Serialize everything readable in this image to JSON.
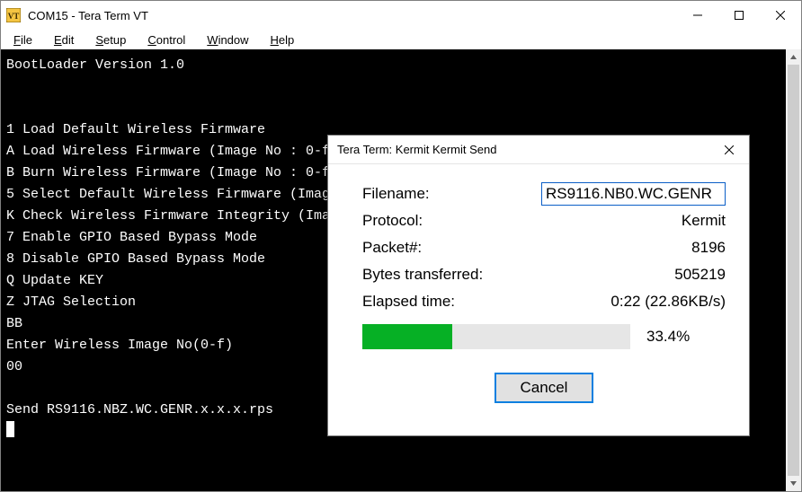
{
  "window": {
    "title": "COM15 - Tera Term VT"
  },
  "menu": {
    "file": {
      "label": "File",
      "accel": "F"
    },
    "edit": {
      "label": "Edit",
      "accel": "E"
    },
    "setup": {
      "label": "Setup",
      "accel": "S"
    },
    "control": {
      "label": "Control",
      "accel": "C"
    },
    "window": {
      "label": "Window",
      "accel": "W"
    },
    "help": {
      "label": "Help",
      "accel": "H"
    }
  },
  "terminal": {
    "lines": [
      "BootLoader Version 1.0",
      "",
      "",
      "1 Load Default Wireless Firmware",
      "A Load Wireless Firmware (Image No : 0-f)",
      "B Burn Wireless Firmware (Image No : 0-f)",
      "5 Select Default Wireless Firmware (Image No : 0-f)",
      "K Check Wireless Firmware Integrity (Image No : 0-f)",
      "7 Enable GPIO Based Bypass Mode",
      "8 Disable GPIO Based Bypass Mode",
      "Q Update KEY",
      "Z JTAG Selection",
      "BB",
      "Enter Wireless Image No(0-f)",
      "00",
      "",
      "Send RS9116.NBZ.WC.GENR.x.x.x.rps"
    ]
  },
  "dialog": {
    "title": "Tera Term: Kermit Kermit Send",
    "labels": {
      "filename": "Filename:",
      "protocol": "Protocol:",
      "packet": "Packet#:",
      "bytes": "Bytes transferred:",
      "elapsed": "Elapsed time:"
    },
    "values": {
      "filename": "RS9116.NB0.WC.GENR",
      "protocol": "Kermit",
      "packet": "8196",
      "bytes": "505219",
      "elapsed": "0:22 (22.86KB/s)",
      "progress_pct": 33.4,
      "progress_pct_label": "33.4%"
    },
    "buttons": {
      "cancel": "Cancel"
    }
  }
}
